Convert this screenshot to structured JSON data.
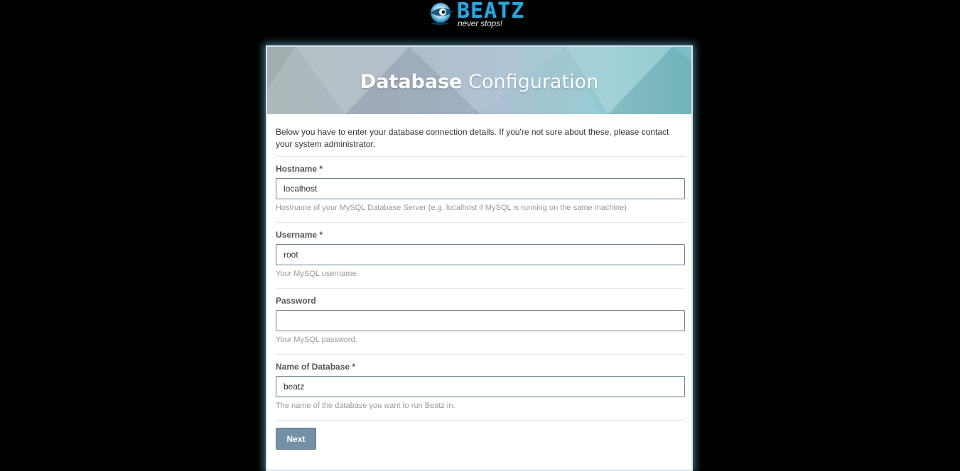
{
  "logo": {
    "wordmark": "BEATZ",
    "tagline": "never stops!"
  },
  "banner": {
    "title_bold": "Database",
    "title_light": "Configuration"
  },
  "intro": "Below you have to enter your database connection details. If you're not sure about these, please contact your system administrator.",
  "fields": {
    "hostname": {
      "label": "Hostname *",
      "value": "localhost",
      "help": "Hostname of your MySQL Database Server (e.g. localhost if MySQL is running on the same machine)"
    },
    "username": {
      "label": "Username *",
      "value": "root",
      "help": "Your MySQL username"
    },
    "password": {
      "label": "Password",
      "value": "",
      "help": "Your MySQL password."
    },
    "database": {
      "label": "Name of Database *",
      "value": "beatz",
      "help": "The name of the database you want to run Beatz in."
    }
  },
  "actions": {
    "next_label": "Next"
  },
  "colors": {
    "background": "#000000",
    "accent": "#2aa7dd",
    "button": "#7390a6",
    "panel_glow": "#78c8e6"
  }
}
